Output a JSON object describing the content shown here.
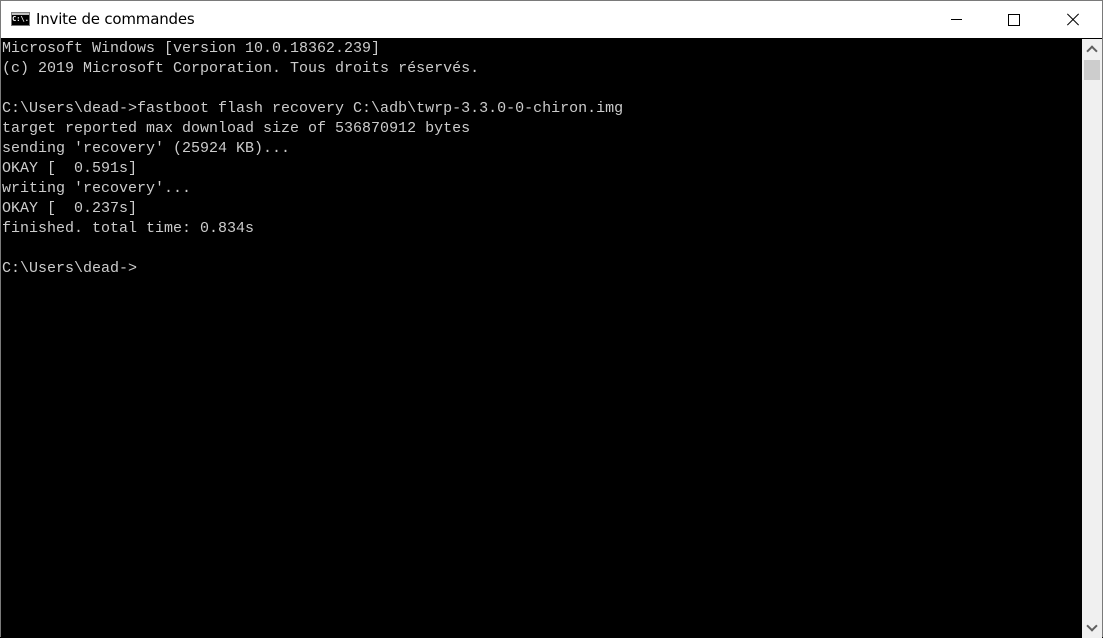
{
  "window": {
    "title": "Invite de commandes",
    "app_icon_text": "C:\\.",
    "buttons": {
      "minimize": "minimize",
      "maximize": "maximize",
      "close": "close"
    }
  },
  "console": {
    "lines": [
      "Microsoft Windows [version 10.0.18362.239]",
      "(c) 2019 Microsoft Corporation. Tous droits réservés.",
      "",
      "C:\\Users\\dead->fastboot flash recovery C:\\adb\\twrp-3.3.0-0-chiron.img",
      "target reported max download size of 536870912 bytes",
      "sending 'recovery' (25924 KB)...",
      "OKAY [  0.591s]",
      "writing 'recovery'...",
      "OKAY [  0.237s]",
      "finished. total time: 0.834s",
      "",
      "C:\\Users\\dead->"
    ],
    "text_color": "#cccccc",
    "background_color": "#000000"
  },
  "scrollbar": {
    "position_fraction": 0.0
  }
}
